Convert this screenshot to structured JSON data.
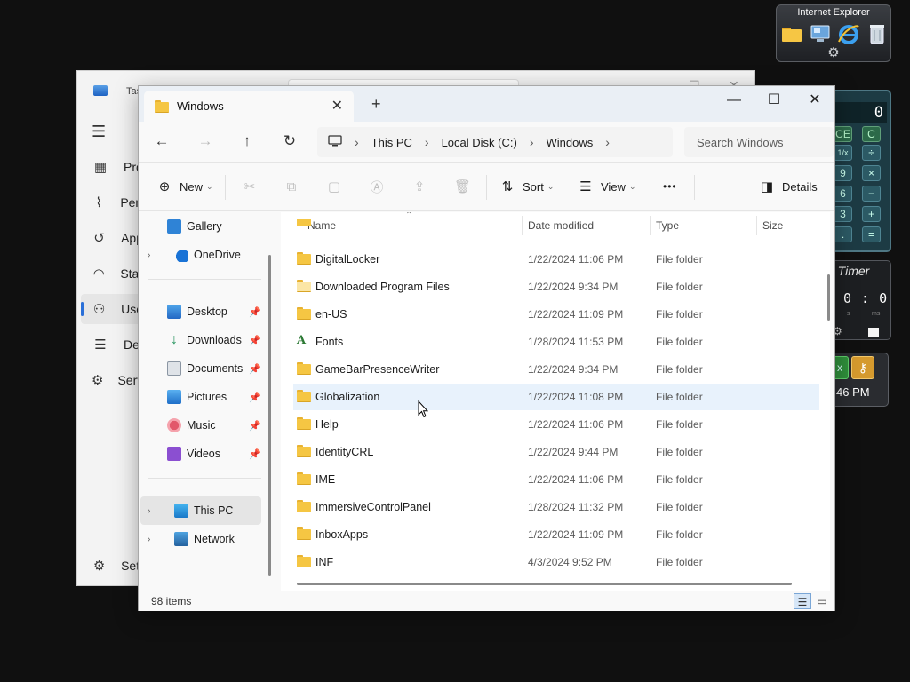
{
  "gadgets": {
    "ie_title": "Internet Explorer",
    "calculator": {
      "display": "0",
      "buttons": [
        "CE",
        "C",
        "1/x",
        "÷",
        "9",
        "×",
        "6",
        "−",
        "3",
        "+",
        ".",
        "="
      ]
    },
    "timer": {
      "title": "g Timer",
      "digits": "0 : 0",
      "label_s": "s",
      "label_ms": "ms"
    },
    "clock": {
      "time": "46 PM"
    }
  },
  "taskmgr": {
    "title": "Tas",
    "nav": [
      {
        "label": "Pro",
        "icon": "processes-icon"
      },
      {
        "label": "Perf",
        "icon": "performance-icon"
      },
      {
        "label": "App",
        "icon": "app-history-icon"
      },
      {
        "label": "Star",
        "icon": "startup-icon"
      },
      {
        "label": "Use",
        "icon": "users-icon"
      },
      {
        "label": "Det",
        "icon": "details-icon"
      },
      {
        "label": "Serv",
        "icon": "services-icon"
      }
    ],
    "settings_label": "Sett"
  },
  "explorer": {
    "tab_title": "Windows",
    "breadcrumb": [
      "This PC",
      "Local Disk (C:)",
      "Windows"
    ],
    "search_placeholder": "Search Windows",
    "commands": {
      "new": "New",
      "sort": "Sort",
      "view": "View",
      "more": "•••",
      "details": "Details"
    },
    "nav": {
      "gallery": "Gallery",
      "onedrive": "OneDrive",
      "desktop": "Desktop",
      "downloads": "Downloads",
      "documents": "Documents",
      "pictures": "Pictures",
      "music": "Music",
      "videos": "Videos",
      "thispc": "This PC",
      "network": "Network"
    },
    "columns": {
      "name": "Name",
      "date": "Date modified",
      "type": "Type",
      "size": "Size"
    },
    "rows": [
      {
        "name": "DigitalLocker",
        "date": "1/22/2024 11:06 PM",
        "type": "File folder"
      },
      {
        "name": "Downloaded Program Files",
        "date": "1/22/2024 9:34 PM",
        "type": "File folder"
      },
      {
        "name": "en-US",
        "date": "1/22/2024 11:09 PM",
        "type": "File folder"
      },
      {
        "name": "Fonts",
        "date": "1/28/2024 11:53 PM",
        "type": "File folder"
      },
      {
        "name": "GameBarPresenceWriter",
        "date": "1/22/2024 9:34 PM",
        "type": "File folder"
      },
      {
        "name": "Globalization",
        "date": "1/22/2024 11:08 PM",
        "type": "File folder"
      },
      {
        "name": "Help",
        "date": "1/22/2024 11:06 PM",
        "type": "File folder"
      },
      {
        "name": "IdentityCRL",
        "date": "1/22/2024 9:44 PM",
        "type": "File folder"
      },
      {
        "name": "IME",
        "date": "1/22/2024 11:06 PM",
        "type": "File folder"
      },
      {
        "name": "ImmersiveControlPanel",
        "date": "1/28/2024 11:32 PM",
        "type": "File folder"
      },
      {
        "name": "InboxApps",
        "date": "1/22/2024 11:09 PM",
        "type": "File folder"
      },
      {
        "name": "INF",
        "date": "4/3/2024 9:52 PM",
        "type": "File folder"
      }
    ],
    "item_count": "98 items"
  }
}
